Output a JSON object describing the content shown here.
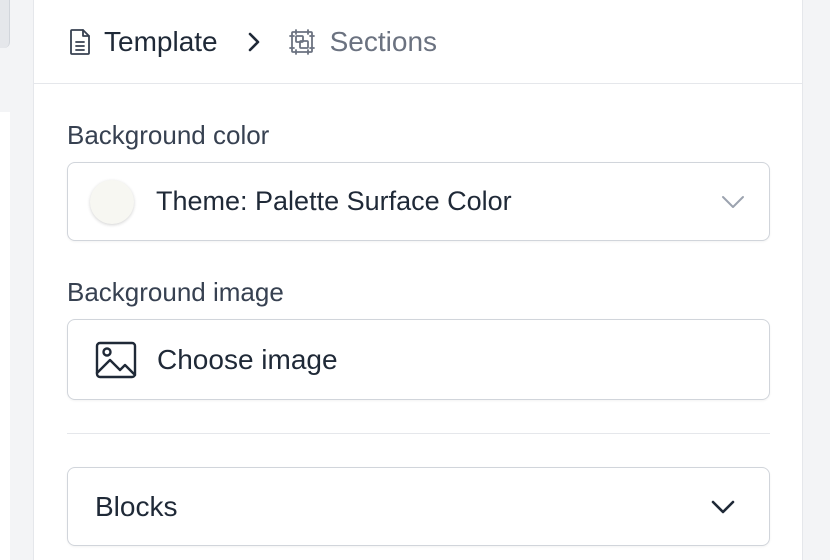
{
  "breadcrumb": {
    "items": [
      {
        "label": "Template",
        "icon": "document-icon"
      },
      {
        "label": "Sections",
        "icon": "sections-icon"
      }
    ],
    "separator_icon": "chevron-right-icon"
  },
  "background_color": {
    "label": "Background color",
    "selected_value": "Theme: Palette Surface Color",
    "swatch_color": "#f7f7f2"
  },
  "background_image": {
    "label": "Background image",
    "button_label": "Choose image",
    "icon": "image-icon"
  },
  "blocks": {
    "label": "Blocks",
    "icon": "chevron-down-icon"
  }
}
